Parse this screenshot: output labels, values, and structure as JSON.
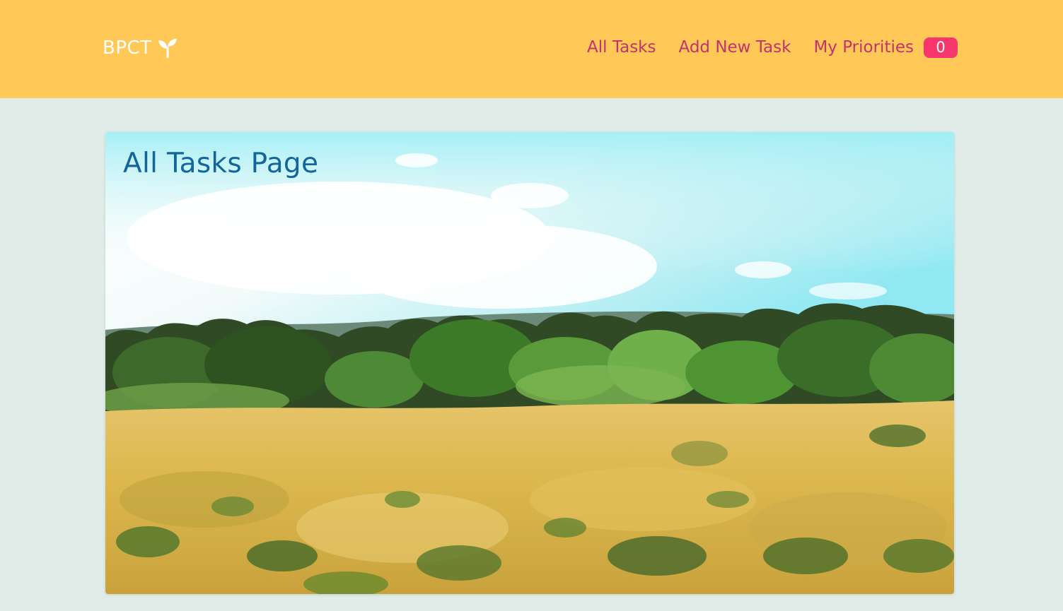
{
  "navbar": {
    "brand": "BPCT",
    "brand_icon": "sprout-icon",
    "links": [
      {
        "label": "All Tasks"
      },
      {
        "label": "Add New Task"
      },
      {
        "label": "My Priorities"
      }
    ],
    "priorities_count": "0"
  },
  "hero": {
    "title": "All Tasks Page",
    "image": "painted-landscape-field"
  },
  "colors": {
    "navbar_bg": "#ffc857",
    "page_bg": "#dfece8",
    "nav_link": "#c0336c",
    "badge_bg": "#f7366d",
    "title": "#14659a"
  }
}
